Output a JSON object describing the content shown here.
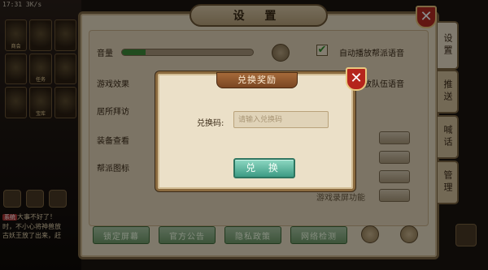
{
  "status_bar": {
    "time": "17:31",
    "network": "3K/s"
  },
  "hud": {
    "grid_labels": [
      "商会",
      "",
      "",
      "",
      "任务",
      "",
      "",
      "宝库",
      ""
    ],
    "chat_lines": [
      {
        "tag": "系统",
        "text": "大事不好了！"
      },
      {
        "tag": "",
        "text": "时，不小心将神兽放"
      },
      {
        "tag": "",
        "text": "古妖王放了出来，赶"
      }
    ]
  },
  "settings": {
    "title": "设 置",
    "rows": {
      "volume_label": "音量",
      "effects_label": "游戏效果",
      "residence_label": "居所拜访",
      "equip_label": "装备查看",
      "icon_label": "帮派图标"
    },
    "volume_level": 0.18,
    "checks": {
      "auto_guild_voice": "自动播放帮派语音",
      "auto_team_voice": "自动播放队伍语音",
      "auto_guild_voice_checked": true,
      "auto_team_voice_checked": true
    },
    "hidden_toggle_label": "游戏录屏功能",
    "tabs": [
      "设置",
      "推送",
      "喊话",
      "管理"
    ],
    "bottom_buttons": [
      "锁定屏幕",
      "官方公告",
      "隐私政策",
      "网络检测"
    ],
    "close_glyph": "✕"
  },
  "redeem": {
    "title": "兑换奖励",
    "code_label": "兑换码:",
    "code_placeholder": "请输入兑换码",
    "button_label": "兑 换",
    "close_glyph": "✕"
  },
  "colors": {
    "accent_green": "#3d9b84",
    "close_red": "#b5251c",
    "panel_bg": "#e8dcc4"
  }
}
